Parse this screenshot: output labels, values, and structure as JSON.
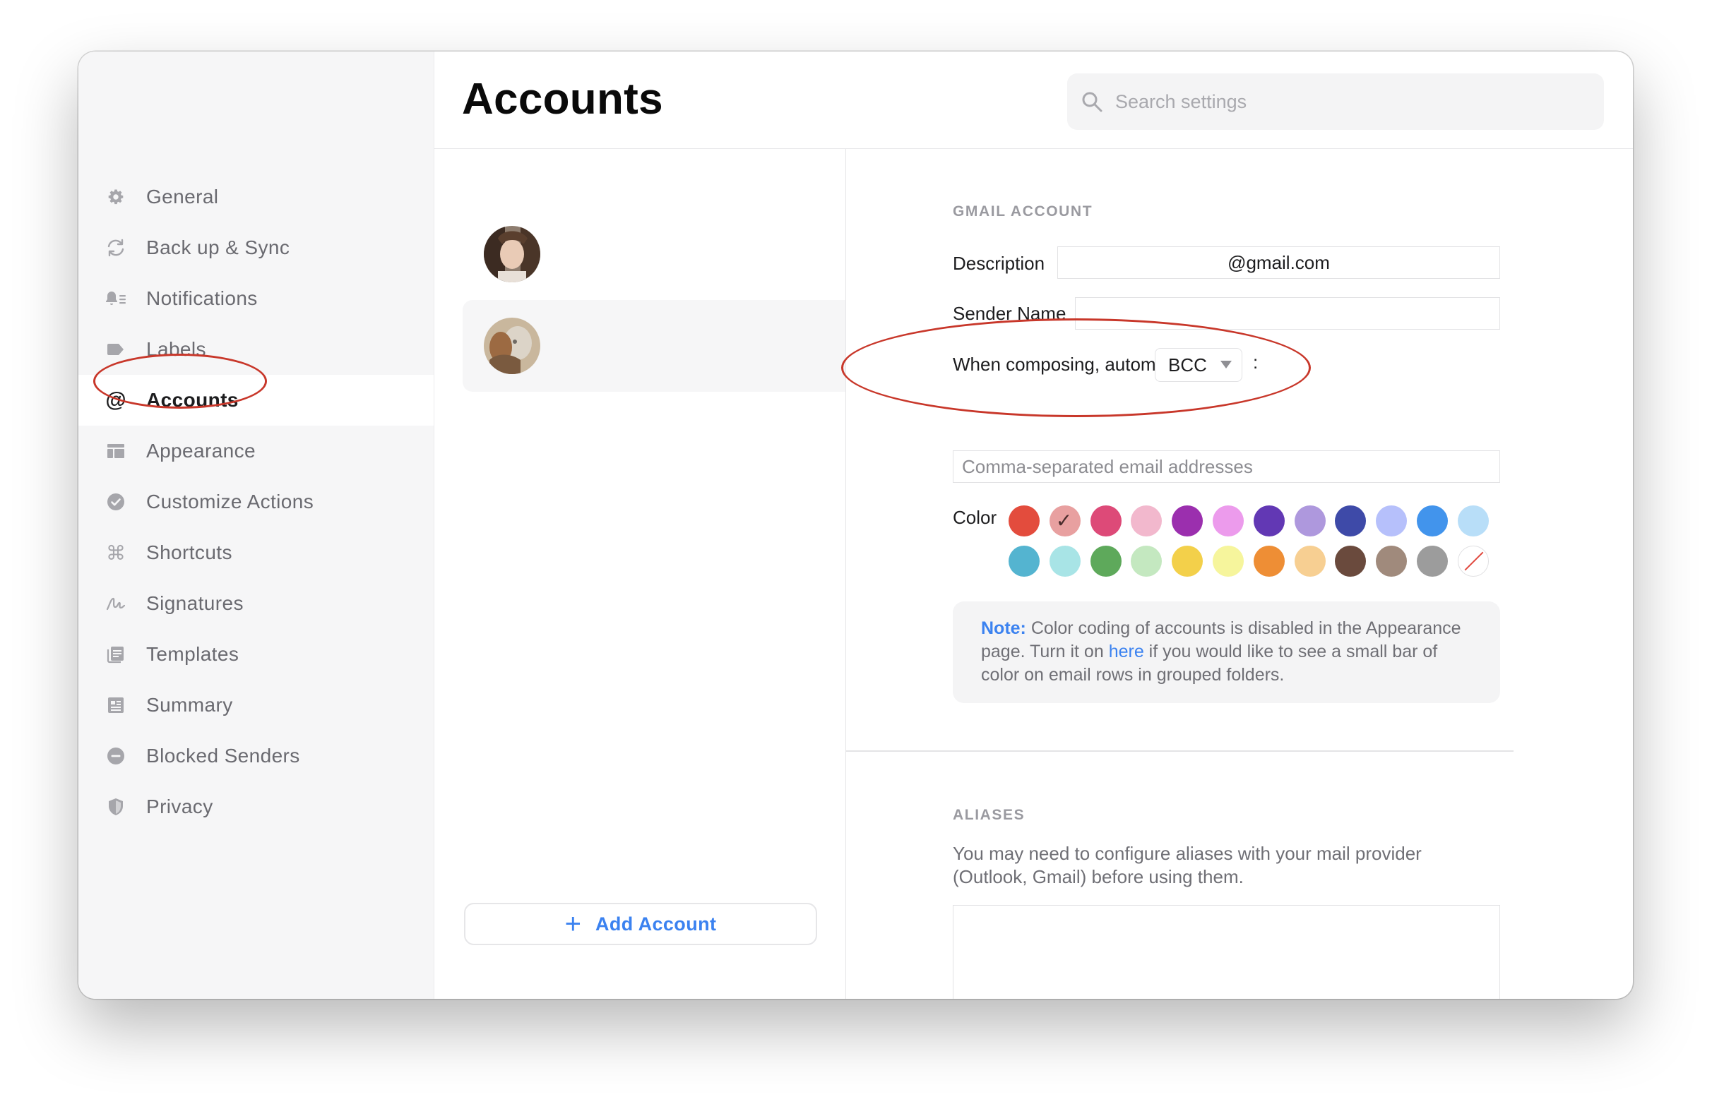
{
  "window": {
    "title": "Accounts"
  },
  "search": {
    "placeholder": "Search settings"
  },
  "sidebar": {
    "items": [
      {
        "label": "General",
        "icon": "gear-icon"
      },
      {
        "label": "Back up & Sync",
        "icon": "sync-icon"
      },
      {
        "label": "Notifications",
        "icon": "bell-icon"
      },
      {
        "label": "Labels",
        "icon": "label-tag-icon"
      },
      {
        "label": "Accounts",
        "icon": "at-icon",
        "active": true
      },
      {
        "label": "Appearance",
        "icon": "layout-icon"
      },
      {
        "label": "Customize Actions",
        "icon": "check-circle-icon"
      },
      {
        "label": "Shortcuts",
        "icon": "command-icon"
      },
      {
        "label": "Signatures",
        "icon": "signature-icon"
      },
      {
        "label": "Templates",
        "icon": "templates-icon"
      },
      {
        "label": "Summary",
        "icon": "summary-icon"
      },
      {
        "label": "Blocked Senders",
        "icon": "blocked-icon"
      },
      {
        "label": "Privacy",
        "icon": "shield-icon"
      }
    ]
  },
  "accounts": {
    "list": [
      {
        "avatar": "avatar-photo-1",
        "selected": false
      },
      {
        "avatar": "avatar-photo-2",
        "selected": true
      }
    ],
    "add_label": "Add Account",
    "add_icon": "+"
  },
  "gmail": {
    "section_title": "GMAIL ACCOUNT",
    "description_label": "Description",
    "description_value": "@gmail.com",
    "sender_name_label": "Sender Name",
    "sender_name_value": "",
    "compose_label": "When composing, automatically",
    "compose_mode": "BCC",
    "compose_colon": ":",
    "emails_placeholder": "Comma-separated email addresses",
    "color_label": "Color",
    "colors": [
      "#e34c3d",
      "#e8a0a0",
      "#dd4a78",
      "#f2b8cd",
      "#9b2fae",
      "#ec9bec",
      "#6238b4",
      "#ae98dd",
      "#3e4aa8",
      "#b6c0fb",
      "#4294ec",
      "#b8def8",
      "#54b4d0",
      "#a8e4e6",
      "#5ea95b",
      "#c4e8c0",
      "#f3d04a",
      "#f6f59c",
      "#ee8e35",
      "#f7cf92",
      "#6a4a3d",
      "#a08a7c",
      "#9c9c9c",
      "none"
    ],
    "selected_color_index": 1,
    "note_strong": "Note:",
    "note_text_1": " Color coding of accounts is disabled in the Appearance page. Turn it on ",
    "note_link": "here",
    "note_text_2": " if you would like to see a small bar of color on email rows in grouped folders."
  },
  "aliases": {
    "section_title": "ALIASES",
    "description": "You may need to configure aliases with your mail provider (Outlook, Gmail) before using them.",
    "add_button": "+",
    "remove_button": "–"
  },
  "annotations": {
    "color": "#c8372a"
  }
}
